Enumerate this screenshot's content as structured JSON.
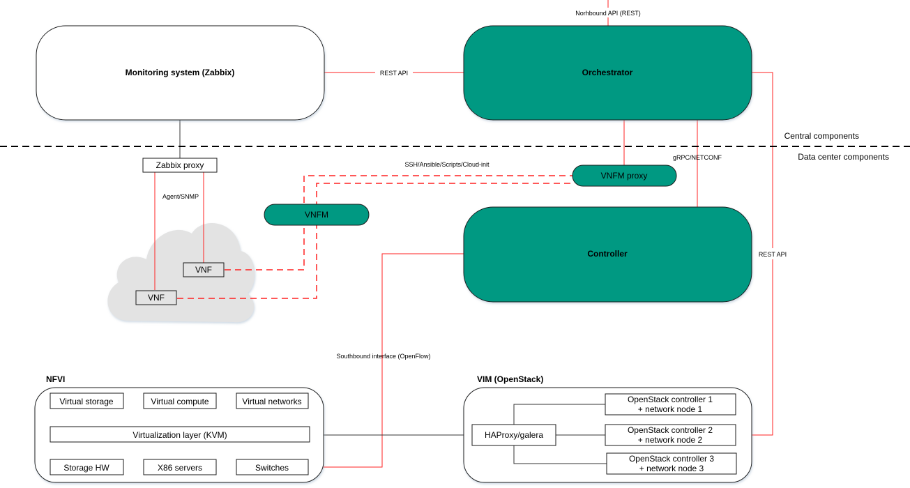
{
  "colors": {
    "teal": "#009982",
    "link_red": "#ff2020",
    "cloud_gray": "#e3e3e3"
  },
  "central": {
    "monitoring": "Monitoring system (Zabbix)",
    "orchestrator": "Orchestrator",
    "northbound": "Norhbound API (REST)",
    "rest_api_left": "REST API",
    "rest_api_right": "REST API"
  },
  "divider": {
    "central_label": "Central components",
    "dc_label": "Data center components"
  },
  "datacenter": {
    "zabbix_proxy": "Zabbix proxy",
    "agent_snmp": "Agent/SNMP",
    "ssh_label": "SSH/Ansible/Scripts/Cloud-init",
    "grpc_label": "gRPC/NETCONF",
    "vnfm_proxy": "VNFM proxy",
    "vnfm": "VNFM",
    "vnf_1": "VNF",
    "vnf_2": "VNF",
    "controller": "Controller",
    "southbound": "Southbound interface (OpenFlow)"
  },
  "nfvi": {
    "title": "NFVI",
    "virtual_storage": "Virtual storage",
    "virtual_compute": "Virtual compute",
    "virtual_networks": "Virtual networks",
    "virtualization_layer": "Virtualization layer (KVM)",
    "storage_hw": "Storage HW",
    "x86_servers": "X86 servers",
    "switches": "Switches"
  },
  "vim": {
    "title": "VIM (OpenStack)",
    "haproxy": "HAProxy/galera",
    "nodes": [
      {
        "line1": "OpenStack controller 1",
        "line2": "+ network node 1"
      },
      {
        "line1": "OpenStack controller 2",
        "line2": "+ network node 2"
      },
      {
        "line1": "OpenStack controller 3",
        "line2": "+ network node 3"
      }
    ]
  }
}
